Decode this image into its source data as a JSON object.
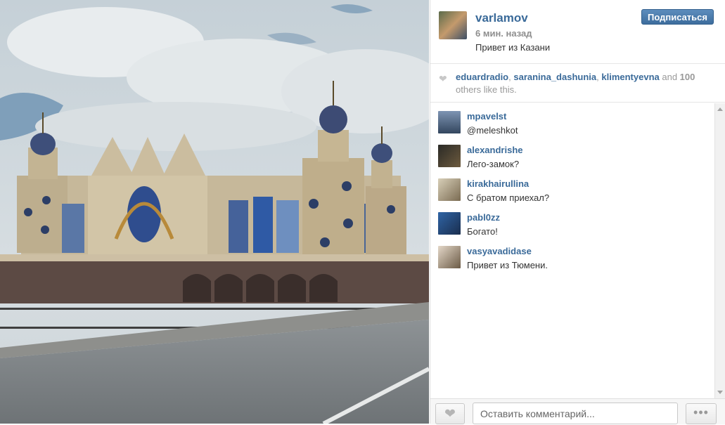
{
  "post": {
    "username": "varlamov",
    "time": "6 мин. назад",
    "caption": "Привет из Казани",
    "follow_label": "Подписаться"
  },
  "likes": {
    "user1": "eduardradio",
    "sep1": ", ",
    "user2": "saranina_dashunia",
    "sep2": ", ",
    "user3": "klimentyevna",
    "and_text": " and ",
    "count": "100",
    "suffix": " others like this."
  },
  "comments": [
    {
      "user": "mpavelst",
      "text": "@meleshkot"
    },
    {
      "user": "alexandrishe",
      "text": "Лего-замок?"
    },
    {
      "user": "kirakhairullina",
      "text": "С братом приехал?"
    },
    {
      "user": "pabl0zz",
      "text": "Богато!"
    },
    {
      "user": "vasyavadidase",
      "text": "Привет из Тюмени."
    }
  ],
  "footer": {
    "comment_placeholder": "Оставить комментарий...",
    "more_label": "•••"
  },
  "icons": {
    "like": "heart-icon",
    "more": "ellipsis-icon"
  },
  "colors": {
    "link": "#3a6a99",
    "button": "#3d6d9d"
  }
}
